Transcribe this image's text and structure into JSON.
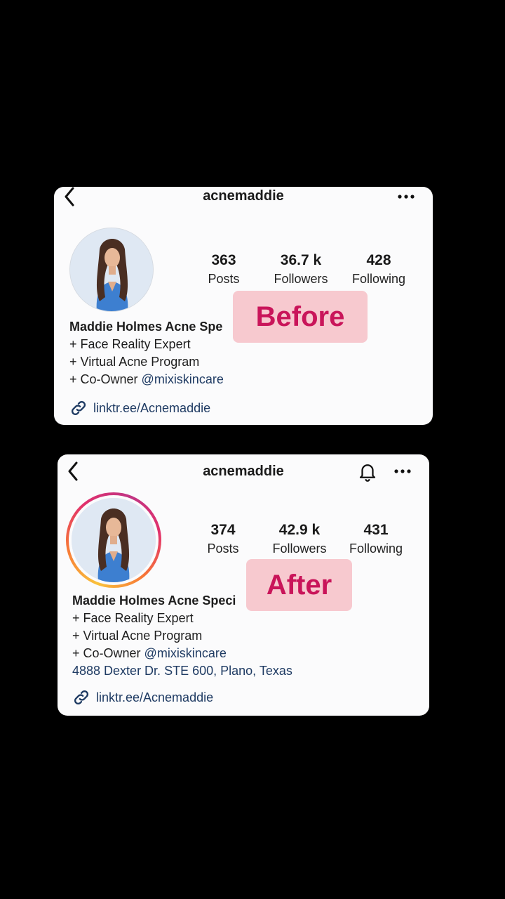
{
  "before": {
    "username": "acnemaddie",
    "stats": [
      {
        "value": "363",
        "label": "Posts"
      },
      {
        "value": "36.7 k",
        "label": "Followers"
      },
      {
        "value": "428",
        "label": "Following"
      }
    ],
    "bio": {
      "name": "Maddie Holmes Acne Spe",
      "line1": "+ Face Reality Expert",
      "line2": "+ Virtual Acne Program",
      "line3_prefix": "+ Co-Owner ",
      "line3_handle": "@mixiskincare"
    },
    "link": "linktr.ee/Acnemaddie",
    "tag": "Before"
  },
  "after": {
    "username": "acnemaddie",
    "stats": [
      {
        "value": "374",
        "label": "Posts"
      },
      {
        "value": "42.9 k",
        "label": "Followers"
      },
      {
        "value": "431",
        "label": "Following"
      }
    ],
    "bio": {
      "name": "Maddie Holmes Acne Speci",
      "line1": "+ Face Reality Expert",
      "line2": "+ Virtual Acne Program",
      "line3_prefix": "+ Co-Owner ",
      "line3_handle": "@mixiskincare",
      "address": "4888 Dexter Dr. STE 600, Plano, Texas"
    },
    "link": "linktr.ee/Acnemaddie",
    "tag": "After"
  },
  "icons": {
    "back": "chevron-left-icon",
    "more": "more-horizontal-icon",
    "bell": "bell-icon",
    "link": "link-icon"
  },
  "colors": {
    "background": "#000000",
    "card": "#fbfbfc",
    "tag_bg": "#f7c9cf",
    "tag_text": "#c9155a",
    "link_text": "#1f3b63"
  }
}
